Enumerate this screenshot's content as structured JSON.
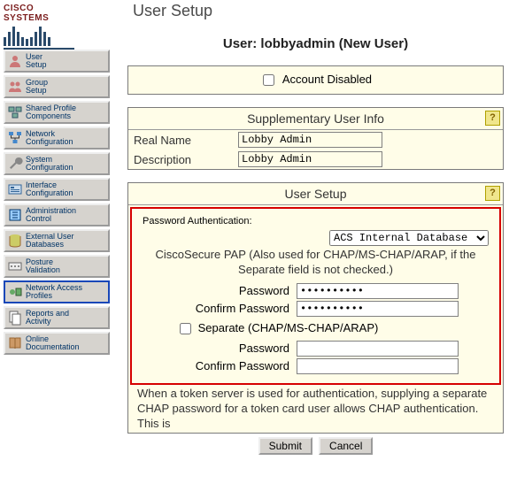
{
  "logo_text": "CISCO SYSTEMS",
  "page_title": "User Setup",
  "user_line_prefix": "User: ",
  "user_line_name": "lobbyadmin",
  "user_line_suffix": " (New User)",
  "account_disabled_label": "Account Disabled",
  "account_disabled_checked": false,
  "supp_info": {
    "header": "Supplementary User Info",
    "real_name_label": "Real Name",
    "real_name_value": "Lobby Admin",
    "description_label": "Description",
    "description_value": "Lobby Admin"
  },
  "user_setup": {
    "header": "User Setup",
    "pw_auth_label": "Password Authentication:",
    "db_selected": "ACS Internal Database",
    "pap_note": "CiscoSecure PAP (Also used for CHAP/MS-CHAP/ARAP, if the Separate field is not checked.)",
    "password_label": "Password",
    "confirm_password_label": "Confirm Password",
    "password_value": "••••••••••",
    "confirm_password_value": "••••••••••",
    "separate_label": "Separate (CHAP/MS-CHAP/ARAP)",
    "separate_checked": false,
    "password2_label": "Password",
    "confirm_password2_label": "Confirm Password",
    "password2_value": "",
    "confirm_password2_value": "",
    "token_note": "When a token server is used for authentication, supplying a separate CHAP password for a token card user allows CHAP authentication. This is"
  },
  "buttons": {
    "submit": "Submit",
    "cancel": "Cancel"
  },
  "sidebar": {
    "items": [
      {
        "label": "User\nSetup"
      },
      {
        "label": "Group\nSetup"
      },
      {
        "label": "Shared Profile\nComponents"
      },
      {
        "label": "Network\nConfiguration"
      },
      {
        "label": "System\nConfiguration"
      },
      {
        "label": "Interface\nConfiguration"
      },
      {
        "label": "Administration\nControl"
      },
      {
        "label": "External User\nDatabases"
      },
      {
        "label": "Posture\nValidation"
      },
      {
        "label": "Network Access\nProfiles"
      },
      {
        "label": "Reports and\nActivity"
      },
      {
        "label": "Online\nDocumentation"
      }
    ]
  }
}
